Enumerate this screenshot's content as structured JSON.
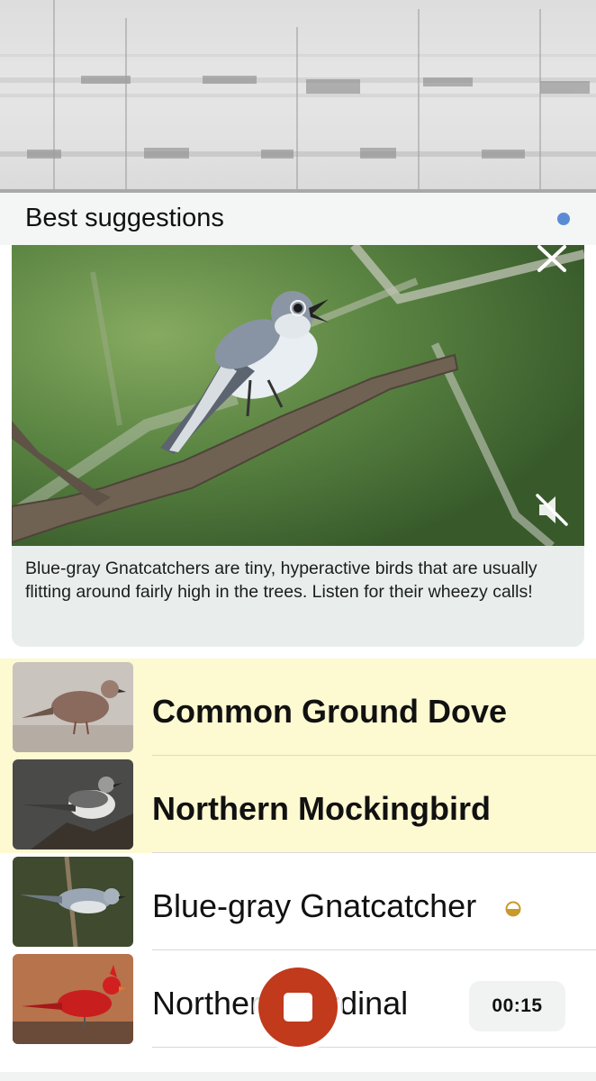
{
  "header": {
    "title": "Best suggestions"
  },
  "featured": {
    "species": "Blue-gray Gnatcatcher",
    "caption": "Blue-gray Gnatcatchers are tiny, hyperactive birds that are usually flitting around fairly high in the trees. Listen for their wheezy calls!",
    "close_icon": "close-icon",
    "mute_icon": "speaker-muted-icon"
  },
  "species_list": [
    {
      "name": "Common Ground Dove",
      "highlighted": true,
      "bold": true
    },
    {
      "name": "Northern Mockingbird",
      "highlighted": true,
      "bold": true
    },
    {
      "name": "Blue-gray Gnatcatcher",
      "highlighted": false,
      "bold": false,
      "indicator_icon": "half-circle-icon"
    },
    {
      "name": "Northern Cardinal",
      "highlighted": false,
      "bold": false
    }
  ],
  "recording": {
    "timer": "00:15",
    "stop_icon": "stop-icon"
  },
  "colors": {
    "status_dot": "#5b8bd6",
    "highlight": "#fdf9d1",
    "stop_button": "#c03a1b",
    "indicator": "#c89a2a"
  }
}
